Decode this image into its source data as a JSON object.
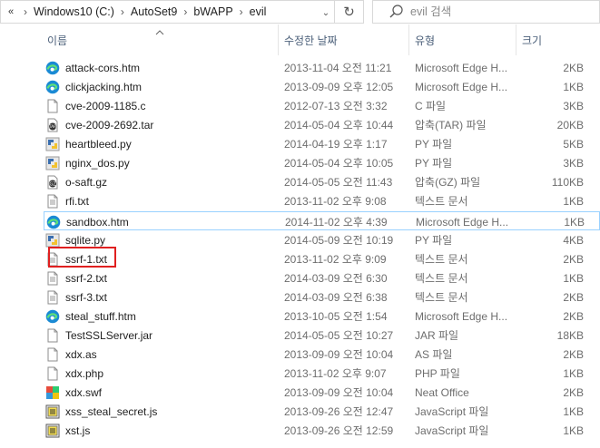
{
  "address": {
    "crumbs": [
      "Windows10 (C:)",
      "AutoSet9",
      "bWAPP",
      "evil"
    ],
    "overflow_glyph": "«",
    "separator": "›",
    "dropdown_glyph": "⌄",
    "refresh_glyph": "↻"
  },
  "search": {
    "placeholder": "evil 검색"
  },
  "columns": {
    "name": "이름",
    "date": "수정한 날짜",
    "type": "유형",
    "size": "크기"
  },
  "files": [
    {
      "name": "attack-cors.htm",
      "date": "2013-11-04 오전 11:21",
      "type": "Microsoft Edge H...",
      "size": "2KB",
      "icon": "edge-icon"
    },
    {
      "name": "clickjacking.htm",
      "date": "2013-09-09 오후 12:05",
      "type": "Microsoft Edge H...",
      "size": "1KB",
      "icon": "edge-icon"
    },
    {
      "name": "cve-2009-1185.c",
      "date": "2012-07-13 오전 3:32",
      "type": "C 파일",
      "size": "3KB",
      "icon": "document-icon"
    },
    {
      "name": "cve-2009-2692.tar",
      "date": "2014-05-04 오후 10:44",
      "type": "압축(TAR) 파일",
      "size": "20KB",
      "icon": "tar-archive-icon"
    },
    {
      "name": "heartbleed.py",
      "date": "2014-04-19 오후 1:17",
      "type": "PY 파일",
      "size": "5KB",
      "icon": "python-icon"
    },
    {
      "name": "nginx_dos.py",
      "date": "2014-05-04 오후 10:05",
      "type": "PY 파일",
      "size": "3KB",
      "icon": "python-icon"
    },
    {
      "name": "o-saft.gz",
      "date": "2014-05-05 오전 11:43",
      "type": "압축(GZ) 파일",
      "size": "110KB",
      "icon": "gz-archive-icon"
    },
    {
      "name": "rfi.txt",
      "date": "2013-11-02 오후 9:08",
      "type": "텍스트 문서",
      "size": "1KB",
      "icon": "text-document-icon"
    },
    {
      "name": "sandbox.htm",
      "date": "2014-11-02 오후 4:39",
      "type": "Microsoft Edge H...",
      "size": "1KB",
      "icon": "edge-icon"
    },
    {
      "name": "sqlite.py",
      "date": "2014-05-09 오전 10:19",
      "type": "PY 파일",
      "size": "4KB",
      "icon": "python-icon"
    },
    {
      "name": "ssrf-1.txt",
      "date": "2013-11-02 오후 9:09",
      "type": "텍스트 문서",
      "size": "2KB",
      "icon": "text-document-icon"
    },
    {
      "name": "ssrf-2.txt",
      "date": "2014-03-09 오전 6:30",
      "type": "텍스트 문서",
      "size": "1KB",
      "icon": "text-document-icon"
    },
    {
      "name": "ssrf-3.txt",
      "date": "2014-03-09 오전 6:38",
      "type": "텍스트 문서",
      "size": "2KB",
      "icon": "text-document-icon"
    },
    {
      "name": "steal_stuff.htm",
      "date": "2013-10-05 오전 1:54",
      "type": "Microsoft Edge H...",
      "size": "2KB",
      "icon": "edge-icon"
    },
    {
      "name": "TestSSLServer.jar",
      "date": "2014-05-05 오전 10:27",
      "type": "JAR 파일",
      "size": "18KB",
      "icon": "document-icon"
    },
    {
      "name": "xdx.as",
      "date": "2013-09-09 오전 10:04",
      "type": "AS 파일",
      "size": "2KB",
      "icon": "document-icon"
    },
    {
      "name": "xdx.php",
      "date": "2013-11-02 오후 9:07",
      "type": "PHP 파일",
      "size": "1KB",
      "icon": "document-icon"
    },
    {
      "name": "xdx.swf",
      "date": "2013-09-09 오전 10:04",
      "type": "Neat Office",
      "size": "2KB",
      "icon": "neat-office-icon"
    },
    {
      "name": "xss_steal_secret.js",
      "date": "2013-09-26 오전 12:47",
      "type": "JavaScript 파일",
      "size": "1KB",
      "icon": "javascript-icon"
    },
    {
      "name": "xst.js",
      "date": "2013-09-26 오전 12:59",
      "type": "JavaScript 파일",
      "size": "1KB",
      "icon": "javascript-icon"
    }
  ],
  "selected_file": "sandbox.htm",
  "highlighted_file": "ssrf-1.txt",
  "colors": {
    "header_text": "#4c607a",
    "selection_border": "#99d1ff",
    "highlight_box": "#e02020"
  }
}
